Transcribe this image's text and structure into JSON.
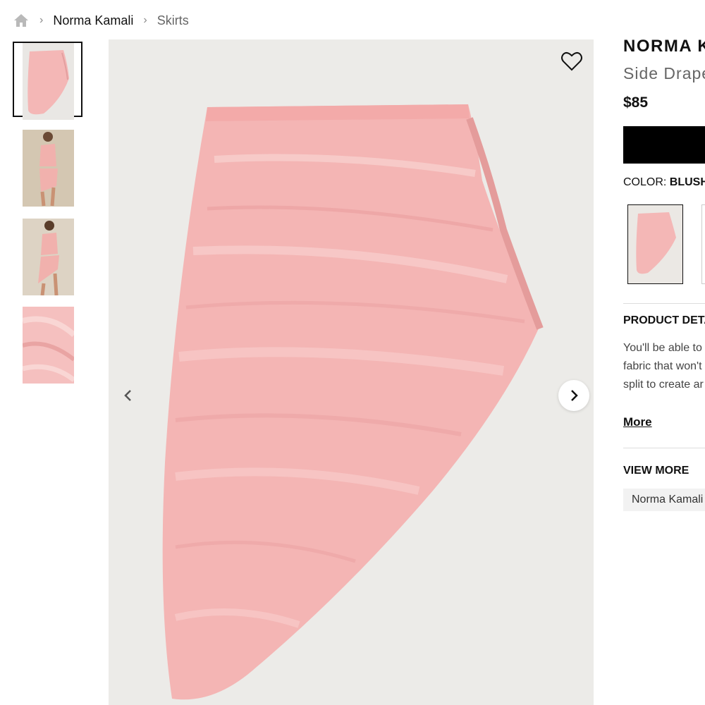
{
  "breadcrumb": {
    "home_icon": "home-icon",
    "items": [
      {
        "label": "Norma Kamali"
      },
      {
        "label": "Skirts"
      }
    ]
  },
  "gallery": {
    "thumbnails": [
      {
        "alt": "skirt-front"
      },
      {
        "alt": "model-front"
      },
      {
        "alt": "model-side"
      },
      {
        "alt": "fabric-detail"
      }
    ],
    "selected_index": 0,
    "wishlist_icon": "heart-icon",
    "prev_icon": "chevron-left-icon",
    "next_icon": "chevron-right-icon"
  },
  "product": {
    "brand": "NORMA K",
    "name": "Side Drape",
    "price": "$85",
    "color_label": "COLOR:",
    "color_value": "BLUSH",
    "details_title": "PRODUCT DETA",
    "description": [
      "You'll be able to",
      "fabric that won't",
      "split to create ar"
    ],
    "more_label": "More",
    "view_more_title": "VIEW MORE",
    "view_more_tag": "Norma Kamali"
  },
  "colors": {
    "skirt": "#f5b8b8",
    "background": "#ebe9e6",
    "button": "#000000"
  }
}
